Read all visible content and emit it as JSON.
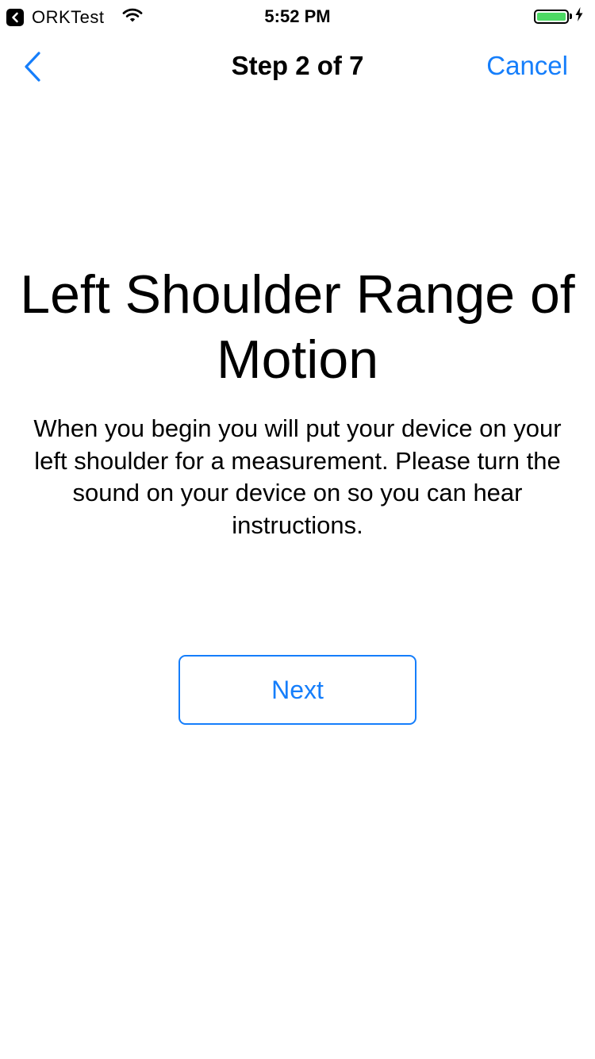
{
  "status_bar": {
    "back_app_label": "ORKTest",
    "time": "5:52 PM",
    "battery_color": "#4cd964"
  },
  "nav": {
    "title": "Step 2 of 7",
    "cancel_label": "Cancel",
    "back_icon": "chevron-left-icon",
    "accent_color": "#157efb"
  },
  "content": {
    "title": "Left Shoulder Range of Motion",
    "text": "When you begin you will put your device on your left shoulder for a measurement. Please turn the sound on your device on so you can hear instructions.",
    "next_label": "Next"
  }
}
